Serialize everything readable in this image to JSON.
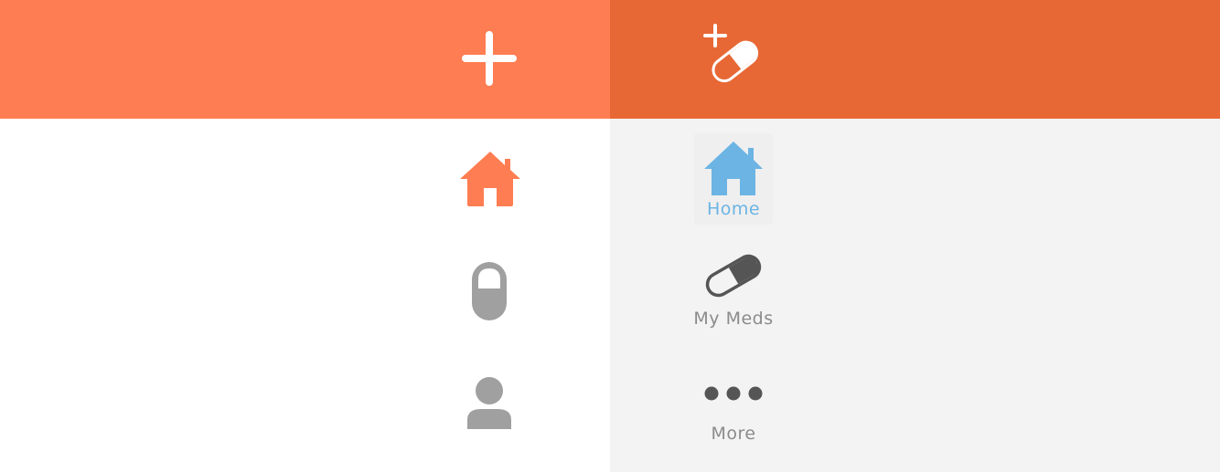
{
  "colors": {
    "left_header_bg": "#ff7d52",
    "right_header_bg": "#e86835",
    "right_panel_bg": "#f3f3f3",
    "active_tab": "#6cb4e4",
    "inactive_text": "#8b8b8b",
    "inactive_icon": "#a0a0a0",
    "dark_icon": "#555555",
    "active_home_left": "#ff7d52"
  },
  "left_panel": {
    "header": {
      "action_icon": "plus-icon"
    },
    "sidebar": {
      "items": [
        {
          "icon": "home-icon",
          "active": true
        },
        {
          "icon": "pill-icon",
          "active": false
        },
        {
          "icon": "person-icon",
          "active": false
        }
      ]
    }
  },
  "right_panel": {
    "header": {
      "action_icon": "add-medication-icon"
    },
    "tabs": [
      {
        "label": "Home",
        "icon": "home-icon",
        "active": true
      },
      {
        "label": "My Meds",
        "icon": "pill-icon",
        "active": false
      },
      {
        "label": "More",
        "icon": "more-dots-icon",
        "active": false
      }
    ]
  }
}
